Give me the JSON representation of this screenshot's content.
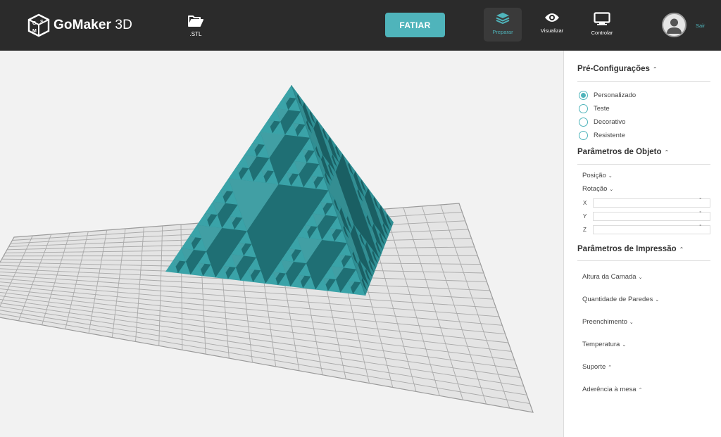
{
  "header": {
    "logo_main": "GoMaker",
    "logo_suffix": "3D",
    "stl_label": ".STL",
    "slice_label": "FATIAR",
    "nav": {
      "prepare": "Preparar",
      "view": "Visualizar",
      "control": "Controlar"
    },
    "logout_label": "Sair"
  },
  "icons": {
    "logo": "gsm-cube-logo-icon",
    "stl": "folder-open-icon",
    "prepare": "layers-icon",
    "view": "eye-icon",
    "control": "monitor-icon",
    "avatar": "user-avatar-icon"
  },
  "colors": {
    "accent": "#4fb4bb",
    "header": "#2b2b2b",
    "model": "#3aa3a8",
    "bed": "#e6e6e6"
  },
  "panel": {
    "presets": {
      "title": "Pré-Configurações",
      "expanded": true,
      "selected": "Personalizado",
      "options": [
        "Personalizado",
        "Teste",
        "Decorativo",
        "Resistente"
      ]
    },
    "object": {
      "title": "Parâmetros de Objeto",
      "position_label": "Posição",
      "rotation_label": "Rotação",
      "axes": [
        {
          "label": "X",
          "value": "",
          "unit": "°"
        },
        {
          "label": "Y",
          "value": "",
          "unit": "°"
        },
        {
          "label": "Z",
          "value": "",
          "unit": "°"
        }
      ]
    },
    "print": {
      "title": "Parâmetros de Impressão",
      "items": [
        {
          "label": "Altura da Camada",
          "expanded": false
        },
        {
          "label": "Quantidade de Paredes",
          "expanded": false
        },
        {
          "label": "Preenchimento",
          "expanded": false
        },
        {
          "label": "Temperatura",
          "expanded": false
        },
        {
          "label": "Suporte",
          "expanded": true
        },
        {
          "label": "Aderência à mesa",
          "expanded": true
        }
      ]
    }
  },
  "viewport": {
    "model": "sierpinski-pyramid"
  }
}
